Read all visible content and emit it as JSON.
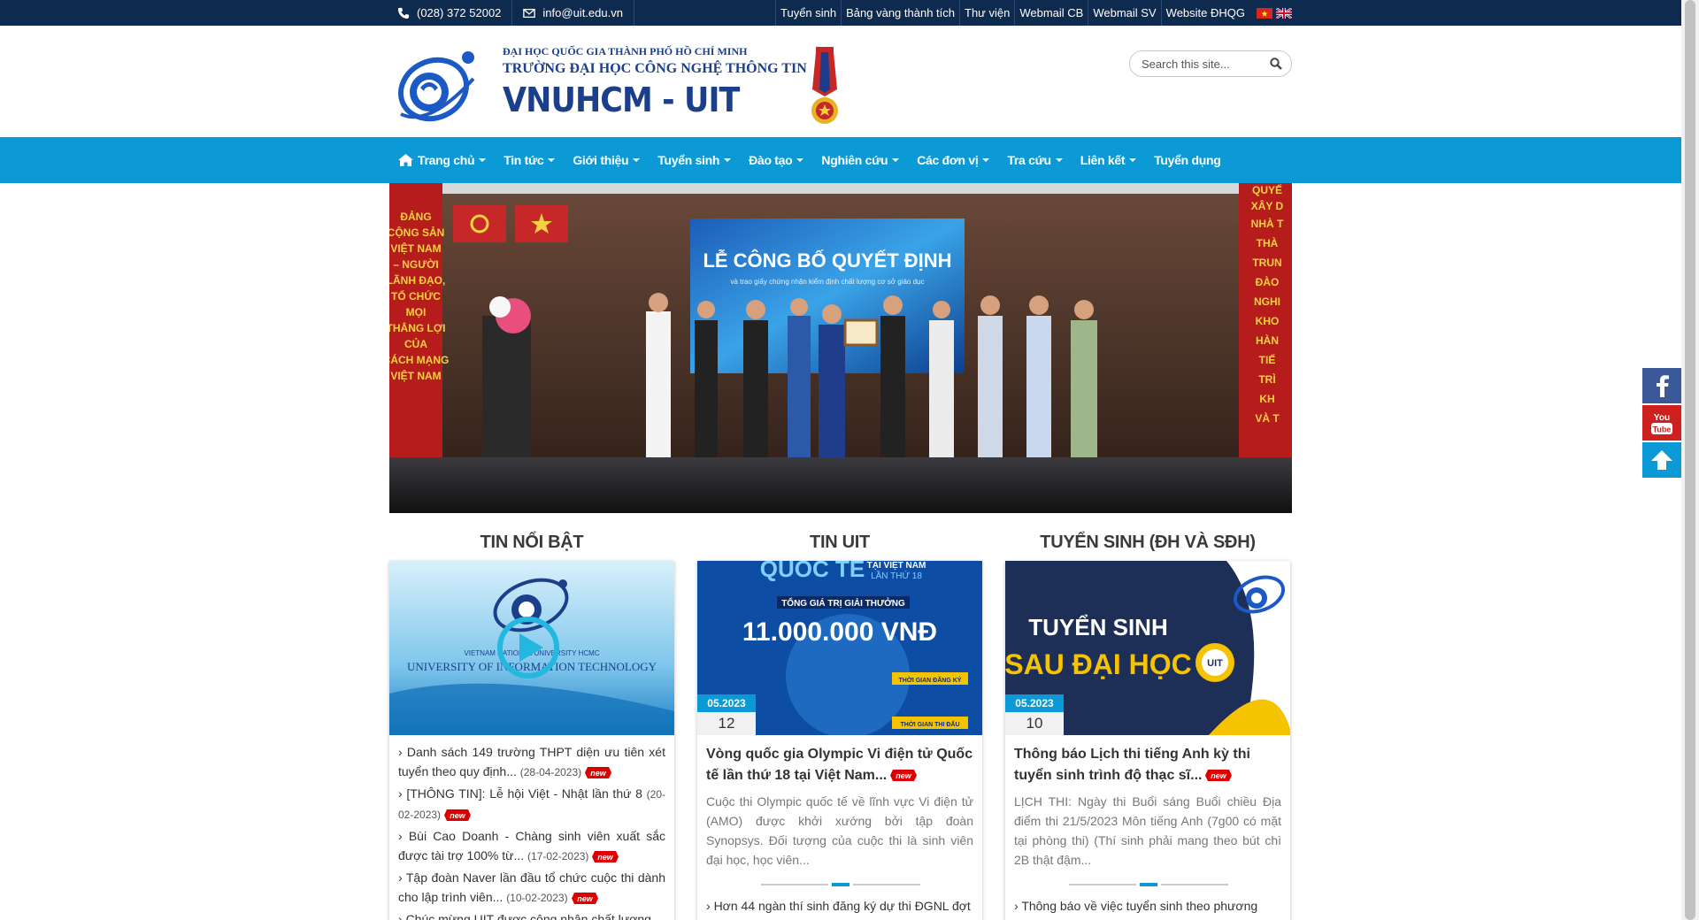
{
  "topbar": {
    "phone": "(028) 372 52002",
    "email": "info@uit.edu.vn",
    "links": [
      "Tuyển sinh",
      "Bảng vàng thành tích",
      "Thư viện",
      "Webmail CB",
      "Webmail SV",
      "Website ĐHQG"
    ]
  },
  "header": {
    "org_line1": "ĐẠI HỌC QUỐC GIA THÀNH PHỐ HỒ CHÍ MINH",
    "org_line2": "TRƯỜNG ĐẠI HỌC CÔNG NGHỆ THÔNG TIN",
    "org_line3": "VNUHCM - UIT",
    "search_placeholder": "Search this site..."
  },
  "nav": {
    "items": [
      "Trang chủ",
      "Tin tức",
      "Giới thiệu",
      "Tuyển sinh",
      "Đào tạo",
      "Nghiên cứu",
      "Các đơn vị",
      "Tra cứu",
      "Liên kết",
      "Tuyển dụng"
    ]
  },
  "hero": {
    "screen_title": "LỄ CÔNG BỐ QUYẾT ĐỊNH",
    "screen_sub": "và trao giấy chứng nhận kiểm định chất lượng cơ sở giáo dục",
    "banner_left": [
      "ĐẢNG",
      "CỘNG SẢN",
      "VIỆT NAM",
      "– NGƯỜI",
      "LÃNH ĐẠO,",
      "TỔ CHỨC",
      "MỌI",
      "THẮNG LỢI",
      "CỦA",
      "CÁCH MẠNG",
      "VIỆT NAM"
    ],
    "banner_right": [
      "QUYẾ",
      "XÂY D",
      "NHÀ T",
      "THÀ",
      "TRUN",
      "ĐÀO",
      "NGHI",
      "KHO",
      "HÀN",
      "TIẾ",
      "TRÌ",
      "KH",
      "VÀ T"
    ]
  },
  "sections": {
    "featured_title": "TIN NỔI BẬT",
    "uit_title": "TIN UIT",
    "admission_title": "TUYỂN SINH (ĐH VÀ SĐH)"
  },
  "featured": {
    "image_text": "VIETNAM NATIONAL UNIVERSITY HCMC",
    "image_text2": "UNIVERSITY OF INFORMATION TECHNOLOGY",
    "items": [
      {
        "text": "Danh sách 149 trường THPT diện ưu tiên xét tuyển theo quy định...",
        "date": "(28-04-2023)"
      },
      {
        "text": "[THÔNG TIN]: Lễ hội Việt - Nhật lần thứ 8",
        "date": "(20-02-2023)"
      },
      {
        "text": "Bùi Cao Doanh - Chàng sinh viên xuất sắc được tài trợ 100% từ...",
        "date": "(17-02-2023)"
      },
      {
        "text": "Tập đoàn Naver lần đầu tổ chức cuộc thi dành cho lập trình viên...",
        "date": "(10-02-2023)"
      },
      {
        "text": "Chúc mừng UIT được công nhận chất lượng",
        "date": ""
      }
    ]
  },
  "uit_news": {
    "month_year": "05.2023",
    "day": "12",
    "image_line1": "QUỐC TẾ",
    "image_line2": "TẠI VIỆT NAM",
    "image_line3": "LẦN THỨ 18",
    "image_prize_label": "TỔNG GIÁ TRỊ GIẢI THƯỞNG",
    "image_prize": "11.000.000 VNĐ",
    "image_reg": "THỜI GIAN ĐĂNG KÝ",
    "image_exam": "THỜI GIAN THI ĐẤU",
    "title": "Vòng quốc gia Olympic Vi điện tử Quốc tế lần thứ 18 tại Việt Nam...",
    "excerpt": "Cuộc thi Olympic quốc tế về lĩnh vực Vi điện tử (AMO) được khởi xướng bởi tập đoàn Synopsys. Đối tượng của cuộc thi là sinh viên đại học, học viên...",
    "more": "Hơn 44 ngàn thí sinh đăng ký dự thi ĐGNL đợt"
  },
  "admission": {
    "month_year": "05.2023",
    "day": "10",
    "image_line1": "TUYỂN SINH",
    "image_line2": "SAU ĐẠI HỌC",
    "image_badge": "UIT",
    "title": "Thông báo Lịch thi tiếng Anh kỳ thi tuyển sinh trình độ thạc sĩ...",
    "excerpt": "LỊCH THI: Ngày thi Buổi sáng Buổi chiều Địa điểm thi 21/5/2023 Môn tiếng Anh (7g00 có mặt tại phòng thi) (Thí sinh phải mang theo bút chì 2B thật đậm...",
    "more": "Thông báo về việc tuyển sinh theo phương"
  },
  "badge_new": "new",
  "colors": {
    "topbar": "#0f2a4f",
    "nav": "#0c9ad6",
    "brand": "#1b3f8b",
    "facebook": "#3b5998",
    "youtube": "#cd201f",
    "backtop": "#0c9ad6"
  }
}
